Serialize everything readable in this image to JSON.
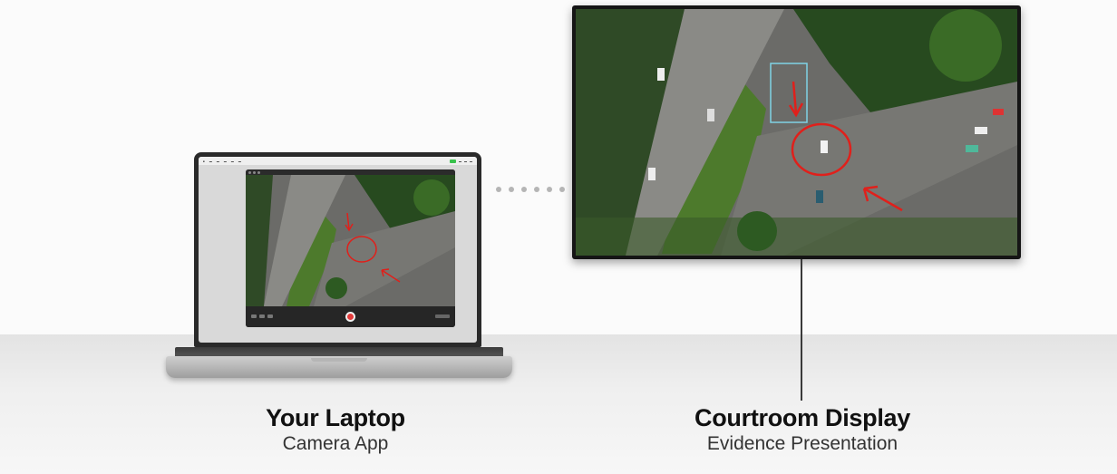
{
  "laptop": {
    "title": "Your Laptop",
    "subtitle": "Camera App"
  },
  "display": {
    "title": "Courtroom Display",
    "subtitle": "Evidence Presentation"
  },
  "colors": {
    "annotation": "#e0201b",
    "record_button": "#e23b3b",
    "background": "#fafafa"
  },
  "icons": [
    "record-icon",
    "connection-dots-icon"
  ]
}
